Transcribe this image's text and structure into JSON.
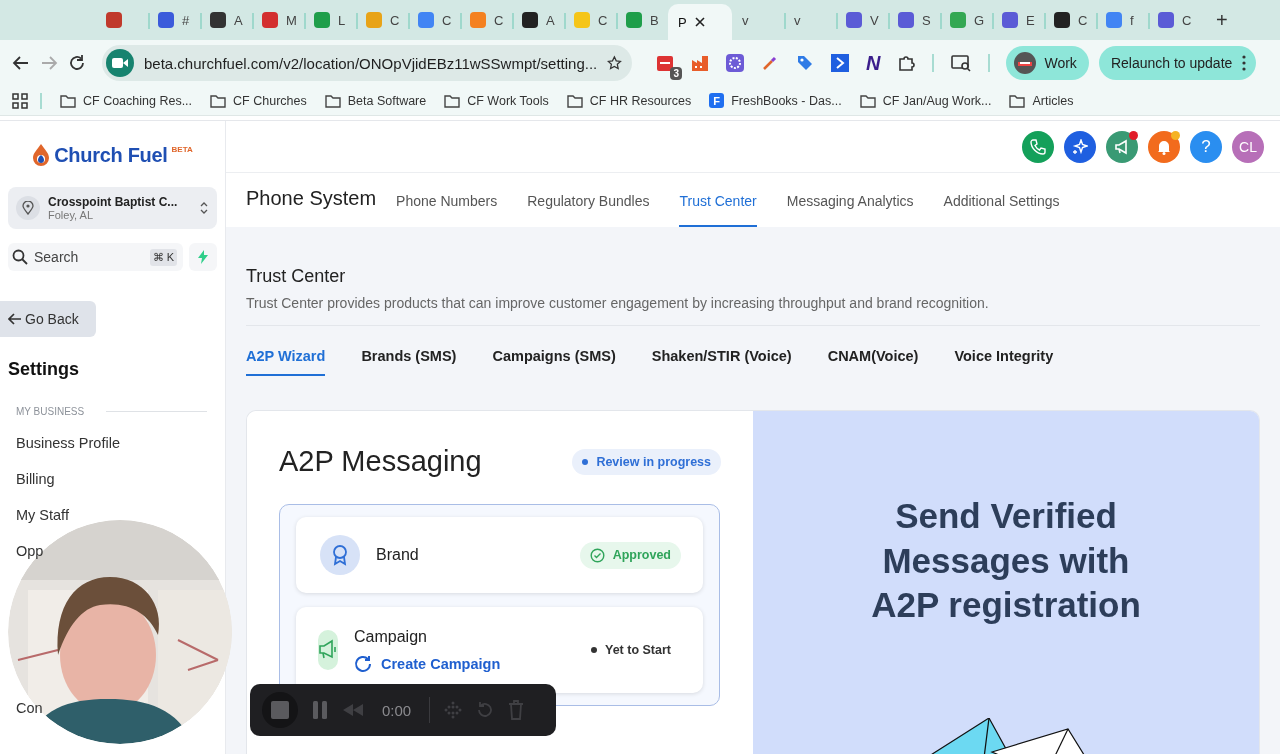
{
  "browser": {
    "tabs": [
      {
        "color": "#c0392b",
        "selected": false
      },
      {
        "label": "#",
        "color": "#3b5bdb",
        "selected": false
      },
      {
        "label": "A",
        "color": "#333333",
        "selected": false
      },
      {
        "label": "M",
        "color": "#d32f2f",
        "selected": false
      },
      {
        "label": "L",
        "color": "#1e9e4a",
        "selected": false
      },
      {
        "label": "C",
        "color": "#e8a317",
        "selected": false
      },
      {
        "label": "C",
        "color": "#4285f4",
        "selected": false
      },
      {
        "label": "C",
        "color": "#f48120",
        "selected": false
      },
      {
        "label": "A",
        "color": "#222222",
        "selected": false
      },
      {
        "label": "C",
        "color": "#f5c518",
        "selected": false
      },
      {
        "label": "B",
        "color": "#1e9e4a",
        "selected": false
      },
      {
        "label": "P",
        "selected": true
      },
      {
        "label": "v",
        "selected": false
      },
      {
        "label": "v",
        "selected": false
      },
      {
        "label": "V",
        "color": "#5b5bd6",
        "selected": false
      },
      {
        "label": "S",
        "color": "#5b5bd6",
        "selected": false
      },
      {
        "label": "G",
        "color": "#34a853",
        "selected": false
      },
      {
        "label": "E",
        "color": "#5b5bd6",
        "selected": false
      },
      {
        "label": "C",
        "color": "#222222",
        "selected": false
      },
      {
        "label": "f",
        "color": "#4285f4",
        "selected": false
      },
      {
        "label": "C",
        "color": "#5b5bd6",
        "selected": false
      }
    ],
    "new_tab": "+",
    "address": "beta.churchfuel.com/v2/location/ONOpVjidEBz11wSSwmpt/setting...",
    "extension_badge": "3",
    "extension_letter": "N",
    "profile": "Work",
    "relaunch": "Relaunch to update",
    "bookmarks": [
      {
        "label": "CF Coaching Res...",
        "kind": "folder"
      },
      {
        "label": "CF Churches",
        "kind": "folder"
      },
      {
        "label": "Beta Software",
        "kind": "folder"
      },
      {
        "label": "CF Work Tools",
        "kind": "folder"
      },
      {
        "label": "CF HR Resources",
        "kind": "folder"
      },
      {
        "label": "FreshBooks - Das...",
        "kind": "site",
        "mark": "F"
      },
      {
        "label": "CF Jan/Aug Work...",
        "kind": "folder"
      },
      {
        "label": "Articles",
        "kind": "folder"
      }
    ]
  },
  "sidebar": {
    "logo": "Church Fuel",
    "logo_badge": "BETA",
    "location": {
      "name": "Crosspoint Baptist C...",
      "place": "Foley, AL"
    },
    "search": {
      "placeholder": "Search",
      "shortcut": "⌘ K"
    },
    "back": "Go Back",
    "title": "Settings",
    "section": "MY BUSINESS",
    "items": [
      "Business Profile",
      "Billing",
      "My Staff",
      "Opp",
      "Con"
    ]
  },
  "header": {
    "help": "?",
    "avatar": "CL"
  },
  "subnav": {
    "title": "Phone System",
    "tabs": [
      {
        "label": "Phone Numbers",
        "selected": false
      },
      {
        "label": "Regulatory Bundles",
        "selected": false
      },
      {
        "label": "Trust Center",
        "selected": true
      },
      {
        "label": "Messaging Analytics",
        "selected": false
      },
      {
        "label": "Additional Settings",
        "selected": false
      }
    ]
  },
  "page": {
    "title": "Trust Center",
    "description": "Trust Center provides products that can improve customer engagement by increasing throughput and brand recognition.",
    "tabs": [
      {
        "label": "A2P Wizard",
        "selected": true
      },
      {
        "label": "Brands (SMS)",
        "selected": false
      },
      {
        "label": "Campaigns (SMS)",
        "selected": false
      },
      {
        "label": "Shaken/STIR (Voice)",
        "selected": false
      },
      {
        "label": "CNAM(Voice)",
        "selected": false
      },
      {
        "label": "Voice Integrity",
        "selected": false
      }
    ],
    "card": {
      "title": "A2P Messaging",
      "status": {
        "label": "Review in progress",
        "kind": "progress"
      },
      "steps": [
        {
          "kind": "brand",
          "title": "Brand",
          "status": {
            "label": "Approved",
            "kind": "done"
          }
        },
        {
          "kind": "campaign",
          "title": "Campaign",
          "action": "Create Campaign",
          "status": {
            "label": "Yet to Start",
            "kind": "todo"
          }
        }
      ],
      "promo": "Send Verified Messages with A2P registration"
    }
  },
  "recorder": {
    "time": "0:00"
  }
}
